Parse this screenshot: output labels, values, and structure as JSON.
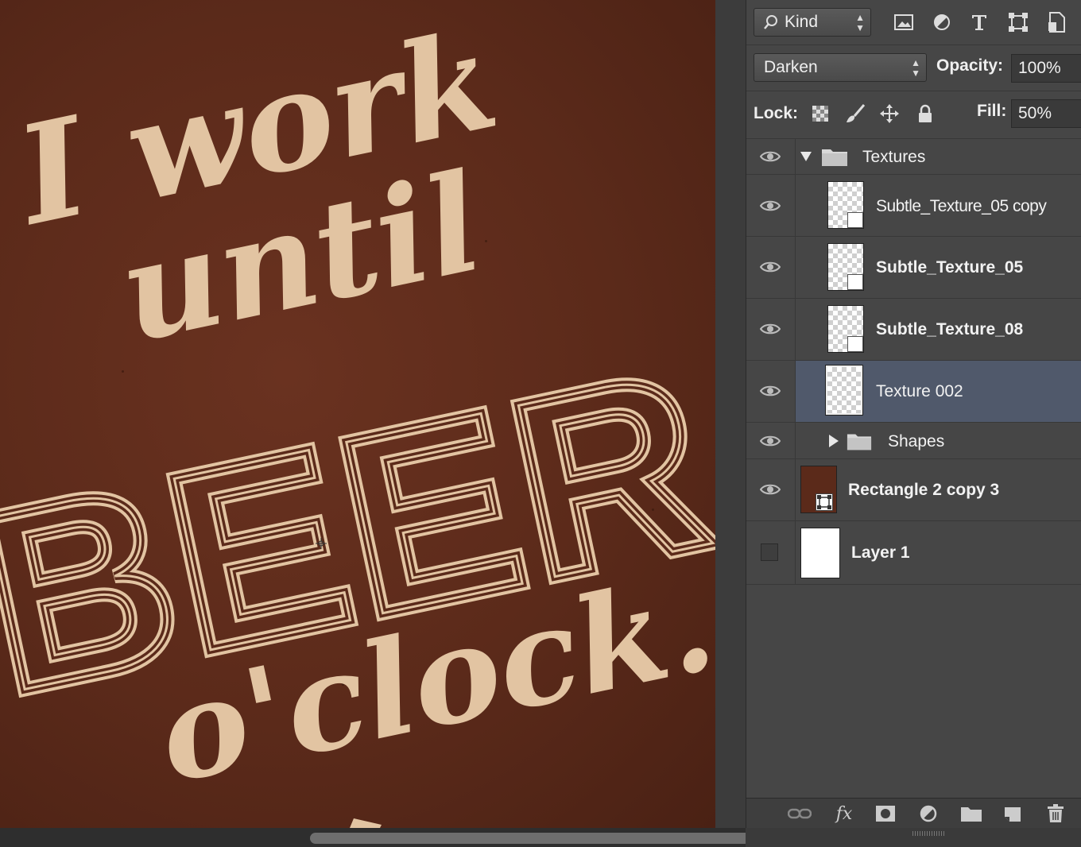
{
  "canvas": {
    "background_color": "#5b2a1a",
    "ink_color": "#e2c4a2",
    "artwork_text": {
      "line1": "I work",
      "line2": "until",
      "line3": "BEER",
      "line4": "o'clock."
    }
  },
  "layers_panel": {
    "filter": {
      "kind_label": "Kind",
      "icons": [
        "image-filter-icon",
        "adjustment-filter-icon",
        "type-filter-icon",
        "shape-filter-icon",
        "smart-object-filter-icon"
      ]
    },
    "blend": {
      "mode": "Darken",
      "opacity_label": "Opacity:",
      "opacity_value": "100%"
    },
    "lock": {
      "label": "Lock:",
      "icons": [
        "lock-transparent-icon",
        "lock-image-icon",
        "lock-position-icon",
        "lock-all-icon"
      ],
      "fill_label": "Fill:",
      "fill_value": "50%"
    },
    "layers": [
      {
        "name": "Textures",
        "type": "group",
        "expanded": true,
        "visible": true
      },
      {
        "name": "Subtle_Texture_05 copy",
        "type": "smart-object",
        "visible": true
      },
      {
        "name": "Subtle_Texture_05",
        "type": "smart-object",
        "visible": true
      },
      {
        "name": "Subtle_Texture_08",
        "type": "smart-object",
        "visible": true
      },
      {
        "name": "Texture 002",
        "type": "pixel",
        "visible": true,
        "selected": true
      },
      {
        "name": "Shapes",
        "type": "group",
        "expanded": false,
        "visible": true
      },
      {
        "name": "Rectangle 2 copy 3",
        "type": "shape",
        "visible": true,
        "swatch": "#5b2a1a"
      },
      {
        "name": "Layer 1",
        "type": "pixel",
        "visible": false
      }
    ],
    "footer_icons": [
      "link-layers-icon",
      "fx-icon",
      "add-mask-icon",
      "new-adjustment-icon",
      "new-group-icon",
      "new-layer-icon",
      "delete-layer-icon"
    ],
    "selected_color": "#50596b"
  }
}
